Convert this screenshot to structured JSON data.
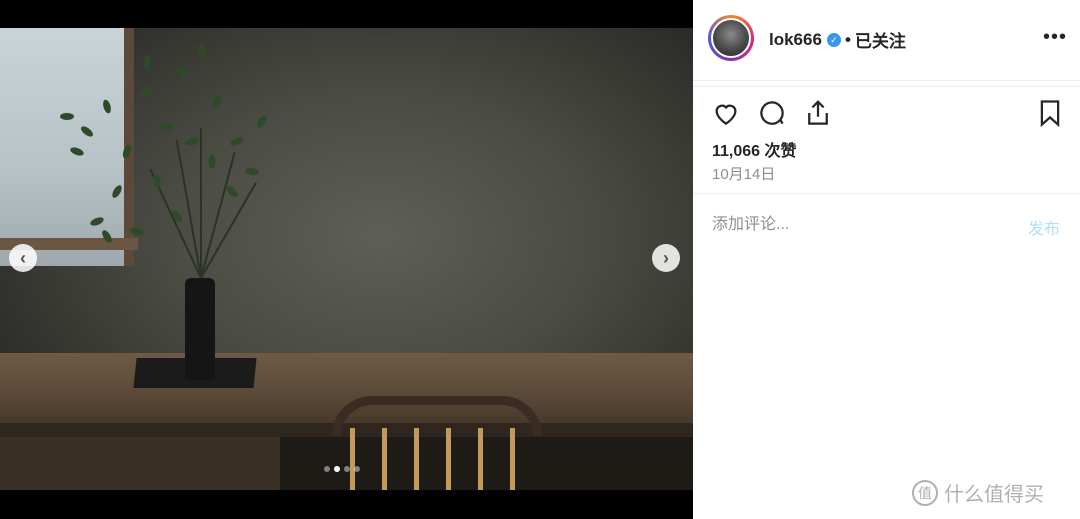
{
  "post": {
    "username": "lok666",
    "separator": "•",
    "follow_status": "已关注",
    "more_icon": "more-horizontal-icon",
    "likes": "11,066 次赞",
    "date": "10月14日"
  },
  "comment": {
    "placeholder": "添加评论...",
    "post_label": "发布"
  },
  "carousel": {
    "prev_icon": "chevron-left-icon",
    "next_icon": "chevron-right-icon",
    "prev_glyph": "‹",
    "next_glyph": "›",
    "slide_count": 4,
    "active_index": 1
  },
  "actions": [
    "heart-icon",
    "comment-icon",
    "share-icon",
    "bookmark-icon"
  ],
  "watermark": {
    "text": "什么值得买",
    "icon_glyph": "值"
  },
  "colors": {
    "verified": "#3897f0",
    "post_button": "#b2dffc",
    "text": "#262626",
    "muted": "#8e8e8e"
  }
}
